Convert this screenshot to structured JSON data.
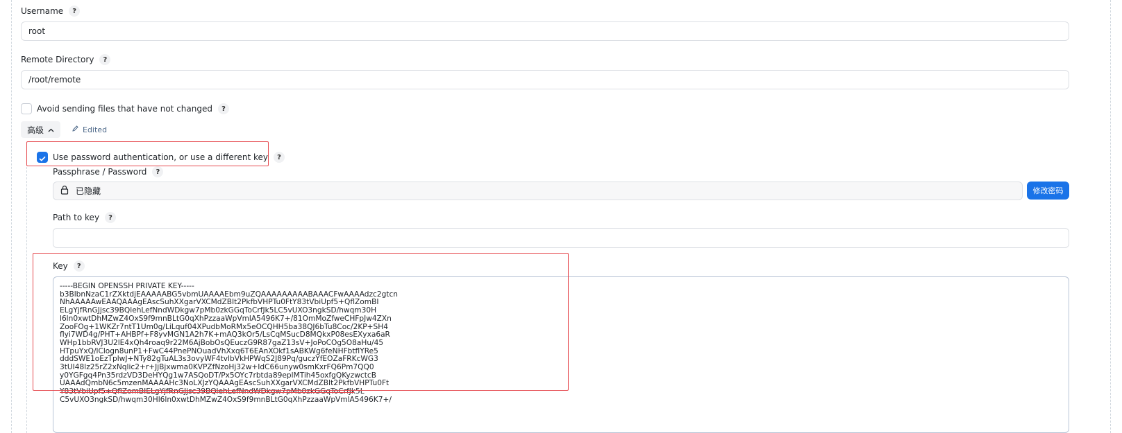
{
  "username": {
    "label": "Username",
    "value": "root"
  },
  "remote_directory": {
    "label": "Remote Directory",
    "value": "/root/remote"
  },
  "avoid_sending": {
    "label": "Avoid sending files that have not changed",
    "checked": false
  },
  "advanced": {
    "label": "高级",
    "edited_label": "Edited"
  },
  "use_password": {
    "label": "Use password authentication, or use a different key",
    "checked": true
  },
  "passphrase": {
    "label": "Passphrase / Password",
    "value": "已隐藏",
    "change_button": "修改密码"
  },
  "path_to_key": {
    "label": "Path to key",
    "value": ""
  },
  "key": {
    "label": "Key",
    "lines": [
      "-----BEGIN OPENSSH PRIVATE KEY-----",
      "b3BlbnNzaC1rZXktdjEAAAAABG5vbmUAAAAEbm9uZQAAAAAAAAABAAACFwAAAAdzc2gtcn",
      "NhAAAAAwEAAQAAAgEAscSuhXXgarVXCMdZBIt2PkfbVHPTu0FtY83tVbiUpf5+QflZomBI",
      "ELgYjfRnGJjsc39BQlehLefNndWDkgw7pMb0zkGGqToCrfJk5LC5vUXO3ngkSD/hwqm30H",
      "l6ln0xwtDhMZwZ4OxS9f9mnBLtG0qXhPzzaaWpVmlA5496K7+/81OmMoZfweCHFpJw4ZXn",
      "ZooFOg+1WKZr7ntT1Um0g/LiLquf04XPudbMoRMx5eOCQHH5ba38QJ6bTu8Coc/2KP+SH4",
      "flyi7WD4g/PHT+AHBPf+F8yvMGN1A2h7K+mAQ3kOr5/LsCqMSucD8MQkxP08esEXyxa6aR",
      "WHp1bbRVJ3U2lE4xQh4roaq9r22M6AjBobOsQEuczG9R87gaZ13sV+JoPoCOg5O8aHu/45",
      "HTpuYxQ/lClogn8unP1+FwC44PnePNOuadVhXxq6T6EAnXOkf1sABKWg6feNHFbtflYRe5",
      "dddSWE1oEzTplwJ+NTy82gTuAL3s3ovyWF4tvlbVkHPWqS2J89Pq/guczYfEOZaFRKcWG3",
      "3tUI48lz25rZ2xNqlic2+r+JjBjxwma0KVPZfNzoHj32w+IdC66unyw0smKxrFQ6Pm7QQ0",
      "y0YGFgq4Pn35rdzVD3DeHYQg1w7ASQoDT/Px5OYc7rbtda89eplMTih45oxfgQKyzwctcB",
      "UAAAdQmbN6c5mzenMAAAAHc3NoLXJzYQAAAgEAscSuhXXgarVXCMdZBIt2PkfbVHPTu0Ft",
      "Y83tVbiUpf5+QflZomBIELgYjfRnGJjsc39BQlehLefNndWDkgw7pMb0zkGGqToCrfJk5L",
      "C5vUXO3ngkSD/hwqm30Hl6ln0xwtDhMZwZ4OxS9f9mnBLtG0qXhPzzaaWpVmlA5496K7+/"
    ]
  },
  "icons": {
    "help": "?",
    "lock": "lock-icon",
    "pencil": "pencil-icon",
    "chevron": "chevron-up-icon",
    "check": "check-icon"
  },
  "colors": {
    "primary": "#1a73e8",
    "highlight": "#e5484d"
  }
}
